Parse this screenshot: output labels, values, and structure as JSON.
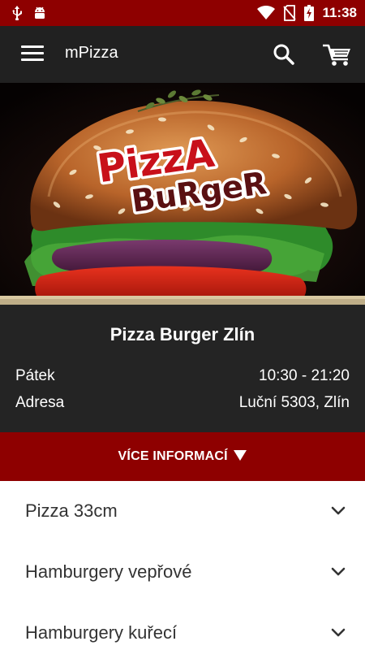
{
  "status_bar": {
    "time": "11:38",
    "icons": [
      "usb-icon",
      "android-debug-icon",
      "wifi-icon",
      "no-sim-icon",
      "battery-charging-icon"
    ]
  },
  "app_bar": {
    "title": "mPizza",
    "icons": [
      "menu-icon",
      "search-icon",
      "cart-icon"
    ]
  },
  "hero": {
    "logo_line1": "PizzA",
    "logo_line2": "BuRgeR"
  },
  "restaurant": {
    "name": "Pizza Burger Zlín",
    "day_label": "Pátek",
    "hours": "10:30 - 21:20",
    "address_label": "Adresa",
    "address": "Luční 5303, Zlín"
  },
  "more_info": {
    "label": "VÍCE INFORMACÍ",
    "icon": "triangle-down-icon"
  },
  "categories": [
    {
      "label": "Pizza 33cm"
    },
    {
      "label": "Hamburgery vepřové"
    },
    {
      "label": "Hamburgery kuřecí"
    }
  ],
  "colors": {
    "brand_red": "#8e0000",
    "dark_bar": "#212121",
    "info_bg": "#242424"
  }
}
